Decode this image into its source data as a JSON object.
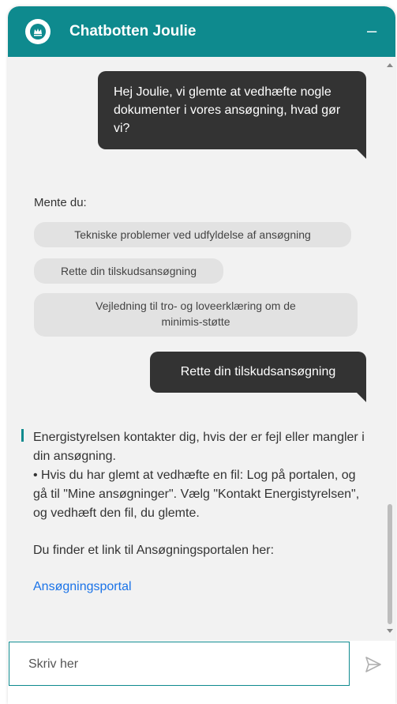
{
  "header": {
    "title": "Chatbotten Joulie",
    "minimize_label": "–"
  },
  "messages": {
    "user1": "Hej Joulie, vi glemte at vedhæfte nogle dokumenter i vores ansøgning, hvad gør vi?",
    "mente": "Mente du:",
    "suggestions": [
      "Tekniske problemer ved udfyldelse af ansøgning",
      "Rette din tilskudsansøgning",
      "Vejledning til tro- og loveerklæring om de minimis-støtte"
    ],
    "user2": "Rette din tilskudsansøgning",
    "bot": {
      "p1": "Energistyrelsen kontakter dig, hvis der er fejl eller mangler i din ansøgning.",
      "p2": "•   Hvis du har glemt at vedhæfte en fil: Log på portalen, og gå til \"Mine ansøgninger\". Vælg \"Kontakt Energistyrelsen\", og vedhæft den fil, du glemte.",
      "p3": "Du finder et link til Ansøgningsportalen her:",
      "link": "Ansøgningsportal"
    }
  },
  "input": {
    "placeholder": "Skriv her"
  },
  "colors": {
    "accent": "#0e8a8e",
    "user_bubble": "#333333",
    "chip": "#e2e2e2",
    "link": "#1a73e8"
  }
}
